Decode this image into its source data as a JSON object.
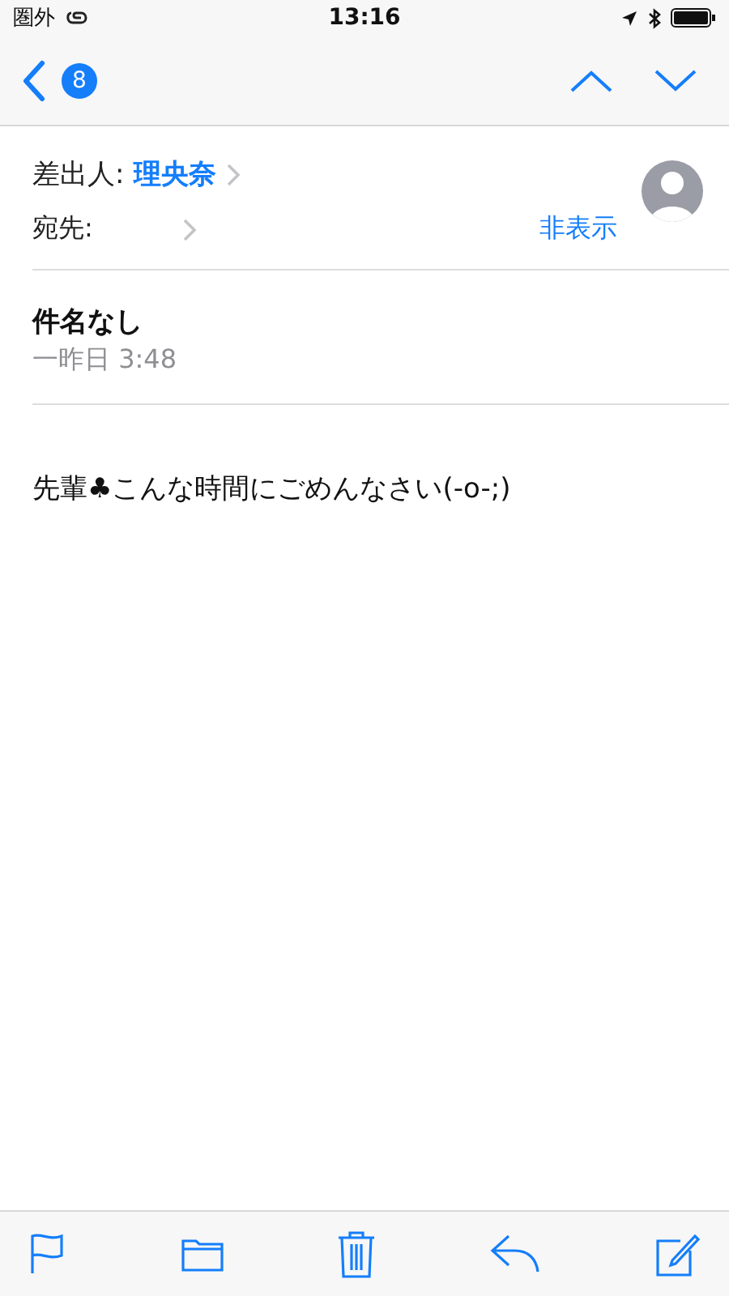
{
  "status_bar": {
    "carrier": "圏外",
    "time": "13:16"
  },
  "nav_bar": {
    "unread_count": "8"
  },
  "header": {
    "from_label": "差出人:",
    "from_name": "理央奈",
    "to_label": "宛先:",
    "hide_link": "非表示"
  },
  "subject": {
    "title": "件名なし",
    "date": "一昨日 3:48"
  },
  "body": "先輩♣こんな時間にごめんなさい(-o-;)"
}
